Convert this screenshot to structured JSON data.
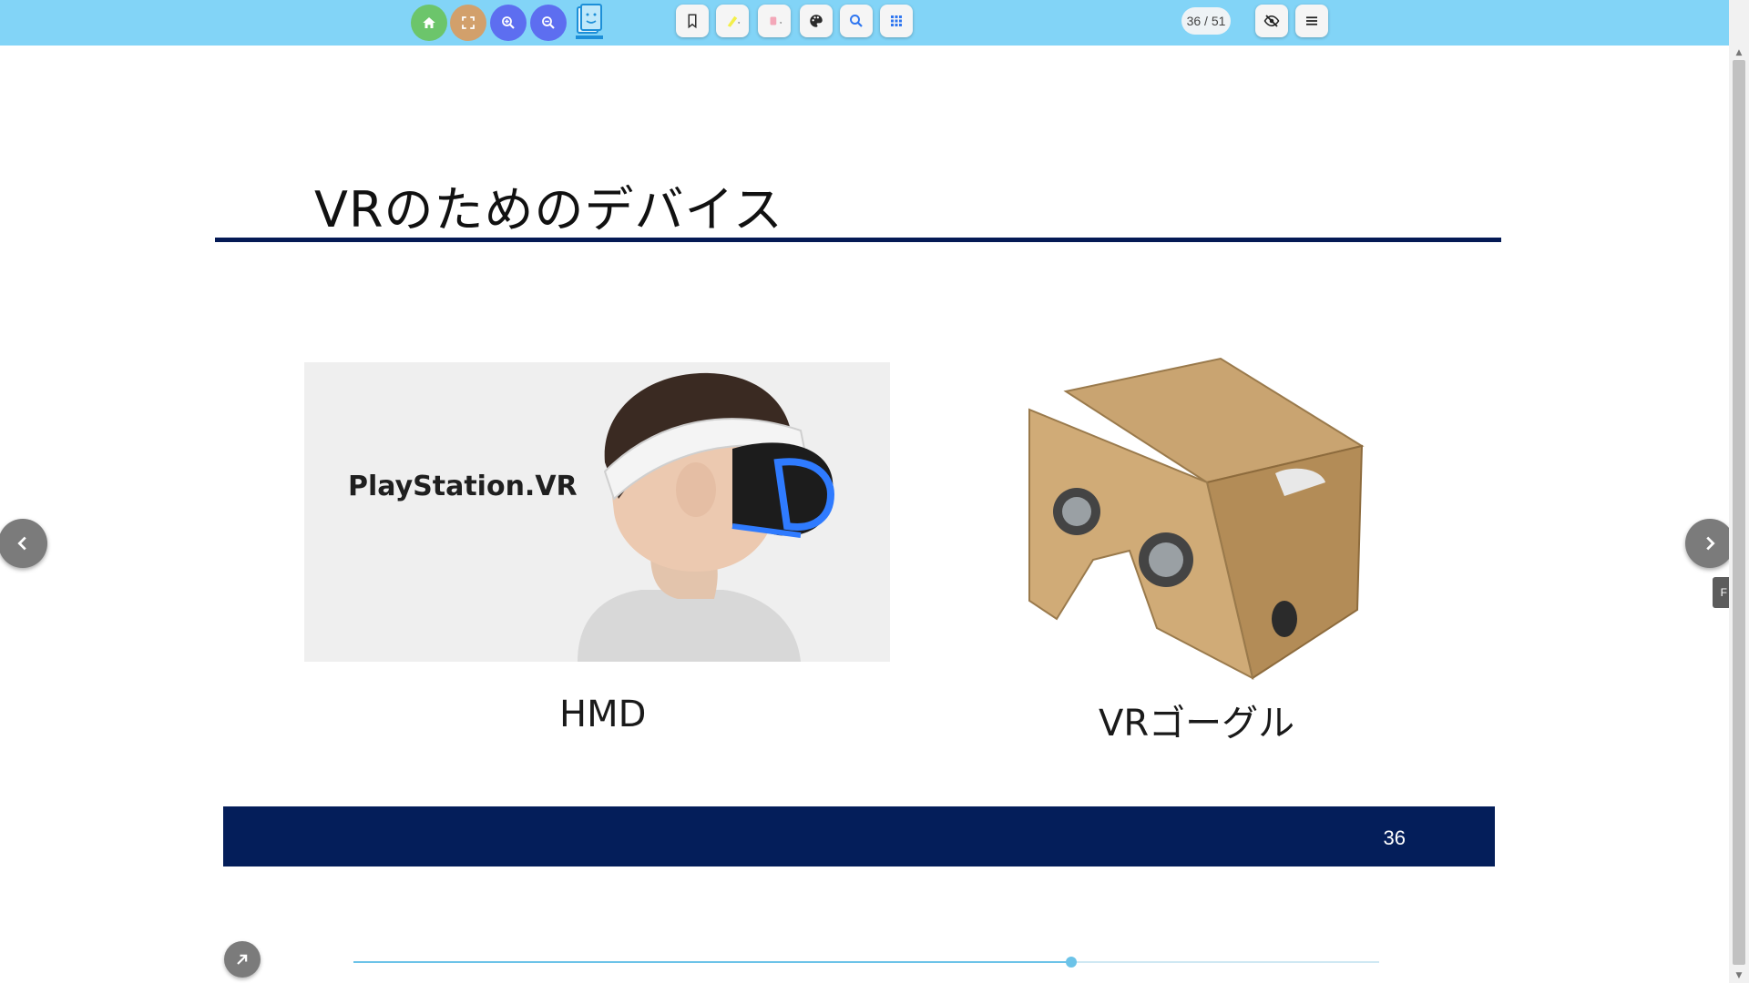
{
  "toolbar": {
    "colors": {
      "background": "#82d4f7",
      "home": "#6cc56b",
      "fullscreen": "#d2a06b",
      "zoom": "#5d6ef0",
      "grid": "#2f76f0"
    },
    "buttons": [
      "home-icon",
      "fullscreen-icon",
      "zoom-in-icon",
      "zoom-out-icon",
      "bookmark-icon",
      "highlighter-icon",
      "eraser-icon",
      "palette-icon",
      "search-icon",
      "grid-icon",
      "eye-off-icon",
      "menu-icon"
    ],
    "page_counter": "36 / 51"
  },
  "slide": {
    "title": "VRのためのデバイス",
    "hmd_brand": "PlayStation.VR",
    "captions": {
      "left": "HMD",
      "right": "VRゴーグル"
    },
    "page_number": "36",
    "colors": {
      "title_rule": "#041a55",
      "footer": "#041e5a"
    }
  },
  "side_tab": {
    "label": "F"
  },
  "progress": {
    "current": 36,
    "total": 51,
    "fraction": 0.7
  }
}
